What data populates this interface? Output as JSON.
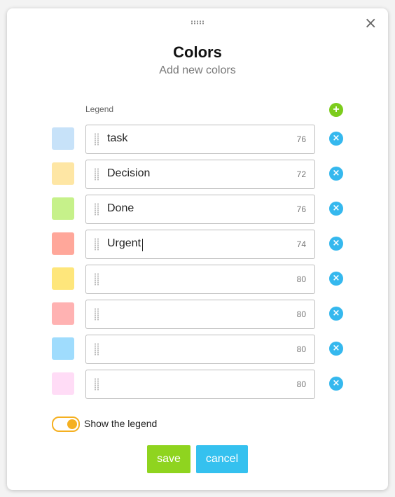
{
  "dialog": {
    "title": "Colors",
    "subtitle": "Add new colors",
    "close_symbol": "×",
    "legend_label": "Legend",
    "add_symbol": "+"
  },
  "colors": [
    {
      "swatch": "#c7e2f9",
      "text": "task",
      "count": "76"
    },
    {
      "swatch": "#fee6a4",
      "text": "Decision",
      "count": "72"
    },
    {
      "swatch": "#c6f18a",
      "text": "Done",
      "count": "76"
    },
    {
      "swatch": "#ffa79a",
      "text": "Urgent",
      "count": "74"
    },
    {
      "swatch": "#fee67b",
      "text": "",
      "count": "80"
    },
    {
      "swatch": "#ffb2b2",
      "text": "",
      "count": "80"
    },
    {
      "swatch": "#9fdcfd",
      "text": "",
      "count": "80"
    },
    {
      "swatch": "#ffdcf6",
      "text": "",
      "count": "80"
    }
  ],
  "remove_symbol": "×",
  "footer": {
    "toggle_label": "Show the legend",
    "toggle_on": true,
    "save_label": "save",
    "cancel_label": "cancel"
  },
  "accent_colors": {
    "add": "#7ccc1c",
    "remove": "#35b8ee",
    "toggle": "#f5b021",
    "save": "#8fd41f",
    "cancel": "#35c1ef"
  }
}
